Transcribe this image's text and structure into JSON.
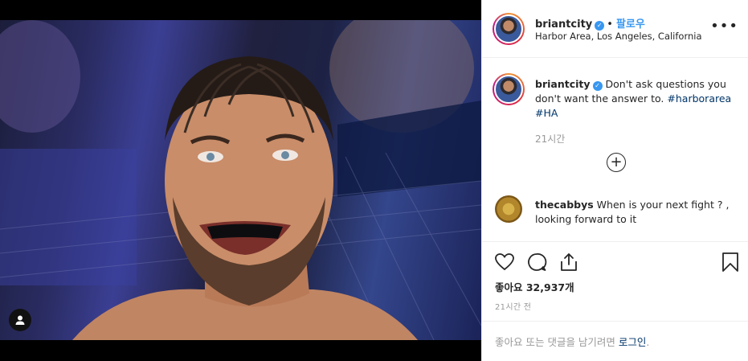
{
  "post": {
    "username": "briantcity",
    "follow_label": "팔로우",
    "location": "Harbor Area, Los Angeles, California",
    "more_icon": "more-options-icon"
  },
  "caption": {
    "username": "briantcity",
    "text": "Don't ask questions you don't want the answer to.",
    "hashtags": [
      "#harborarea",
      "#HA"
    ],
    "time": "21시간"
  },
  "comments": [
    {
      "username": "thecabbys",
      "text": "When is your next fight ? , looking forward to it"
    }
  ],
  "actions": {
    "icons": [
      "heart-icon",
      "comment-icon",
      "share-icon",
      "bookmark-icon"
    ],
    "likes": "좋아요 32,937개",
    "timestamp": "21시간 전"
  },
  "login": {
    "prompt": "좋아요 또는 댓글을 남기려면",
    "link": "로그인",
    "trailing": "."
  },
  "colors": {
    "link_blue": "#3897f0",
    "hashtag": "#003569",
    "muted": "#999999",
    "border": "#efefef"
  }
}
